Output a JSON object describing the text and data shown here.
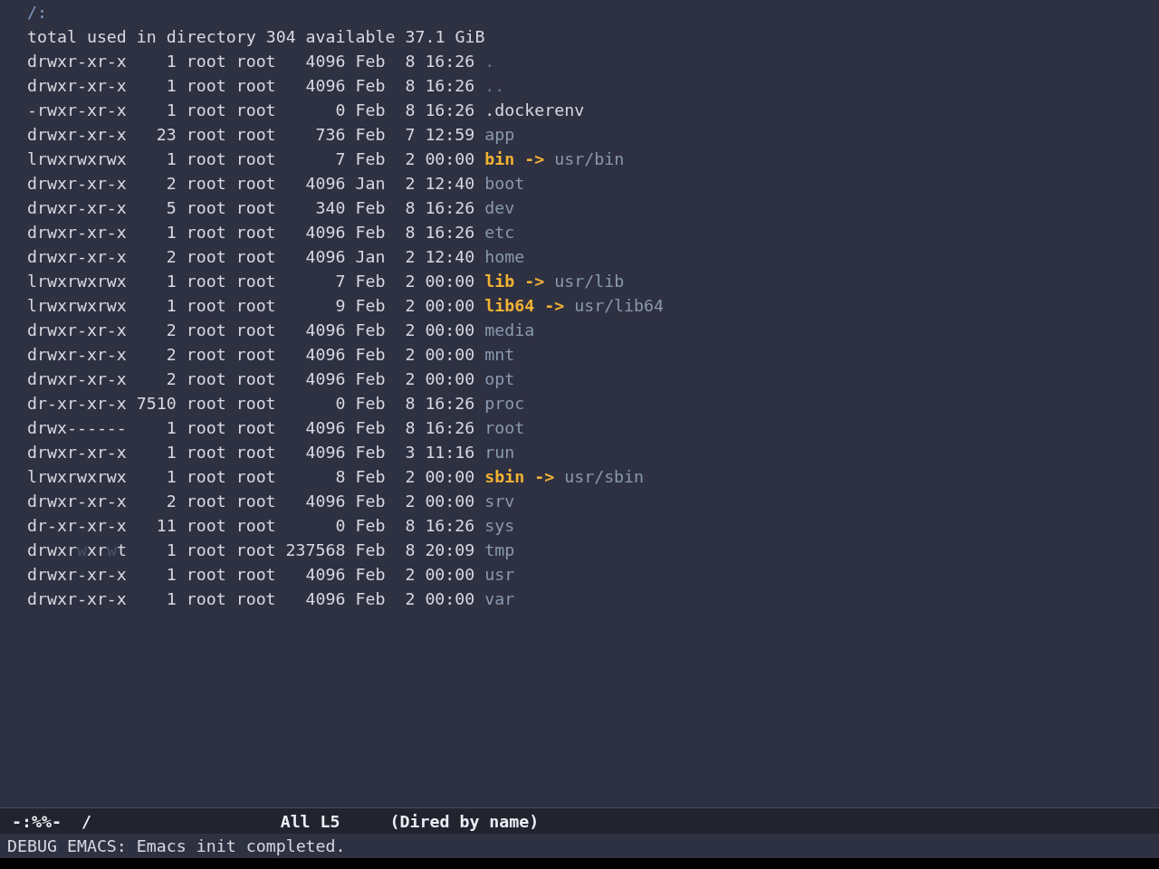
{
  "buffer": {
    "header": "/:",
    "summary": "total used in directory 304 available 37.1 GiB",
    "entries": [
      {
        "kind": "dot",
        "perms": "drwxr-xr-x",
        "write_highlight": false,
        "links": "1",
        "owner": "root",
        "group": "root",
        "size": "4096",
        "month": "Feb",
        "day": "8",
        "time": "16:26",
        "name": "."
      },
      {
        "kind": "dot",
        "perms": "drwxr-xr-x",
        "write_highlight": false,
        "links": "1",
        "owner": "root",
        "group": "root",
        "size": "4096",
        "month": "Feb",
        "day": "8",
        "time": "16:26",
        "name": ".."
      },
      {
        "kind": "file",
        "perms": "-rwxr-xr-x",
        "write_highlight": false,
        "links": "1",
        "owner": "root",
        "group": "root",
        "size": "0",
        "month": "Feb",
        "day": "8",
        "time": "16:26",
        "name": ".dockerenv"
      },
      {
        "kind": "dir",
        "perms": "drwxr-xr-x",
        "write_highlight": false,
        "links": "23",
        "owner": "root",
        "group": "root",
        "size": "736",
        "month": "Feb",
        "day": "7",
        "time": "12:59",
        "name": "app"
      },
      {
        "kind": "symlink",
        "perms": "lrwxrwxrwx",
        "write_highlight": false,
        "links": "1",
        "owner": "root",
        "group": "root",
        "size": "7",
        "month": "Feb",
        "day": "2",
        "time": "00:00",
        "name": "bin",
        "arrow": "->",
        "target": "usr/bin"
      },
      {
        "kind": "dir",
        "perms": "drwxr-xr-x",
        "write_highlight": false,
        "links": "2",
        "owner": "root",
        "group": "root",
        "size": "4096",
        "month": "Jan",
        "day": "2",
        "time": "12:40",
        "name": "boot"
      },
      {
        "kind": "dir",
        "perms": "drwxr-xr-x",
        "write_highlight": false,
        "links": "5",
        "owner": "root",
        "group": "root",
        "size": "340",
        "month": "Feb",
        "day": "8",
        "time": "16:26",
        "name": "dev"
      },
      {
        "kind": "dir",
        "perms": "drwxr-xr-x",
        "write_highlight": false,
        "links": "1",
        "owner": "root",
        "group": "root",
        "size": "4096",
        "month": "Feb",
        "day": "8",
        "time": "16:26",
        "name": "etc"
      },
      {
        "kind": "dir",
        "perms": "drwxr-xr-x",
        "write_highlight": false,
        "links": "2",
        "owner": "root",
        "group": "root",
        "size": "4096",
        "month": "Jan",
        "day": "2",
        "time": "12:40",
        "name": "home"
      },
      {
        "kind": "symlink",
        "perms": "lrwxrwxrwx",
        "write_highlight": false,
        "links": "1",
        "owner": "root",
        "group": "root",
        "size": "7",
        "month": "Feb",
        "day": "2",
        "time": "00:00",
        "name": "lib",
        "arrow": "->",
        "target": "usr/lib"
      },
      {
        "kind": "symlink",
        "perms": "lrwxrwxrwx",
        "write_highlight": false,
        "links": "1",
        "owner": "root",
        "group": "root",
        "size": "9",
        "month": "Feb",
        "day": "2",
        "time": "00:00",
        "name": "lib64",
        "arrow": "->",
        "target": "usr/lib64"
      },
      {
        "kind": "dir",
        "perms": "drwxr-xr-x",
        "write_highlight": false,
        "links": "2",
        "owner": "root",
        "group": "root",
        "size": "4096",
        "month": "Feb",
        "day": "2",
        "time": "00:00",
        "name": "media"
      },
      {
        "kind": "dir",
        "perms": "drwxr-xr-x",
        "write_highlight": false,
        "links": "2",
        "owner": "root",
        "group": "root",
        "size": "4096",
        "month": "Feb",
        "day": "2",
        "time": "00:00",
        "name": "mnt"
      },
      {
        "kind": "dir",
        "perms": "drwxr-xr-x",
        "write_highlight": false,
        "links": "2",
        "owner": "root",
        "group": "root",
        "size": "4096",
        "month": "Feb",
        "day": "2",
        "time": "00:00",
        "name": "opt"
      },
      {
        "kind": "dir",
        "perms": "dr-xr-xr-x",
        "write_highlight": false,
        "links": "7510",
        "owner": "root",
        "group": "root",
        "size": "0",
        "month": "Feb",
        "day": "8",
        "time": "16:26",
        "name": "proc"
      },
      {
        "kind": "dir",
        "perms": "drwx------",
        "write_highlight": false,
        "links": "1",
        "owner": "root",
        "group": "root",
        "size": "4096",
        "month": "Feb",
        "day": "8",
        "time": "16:26",
        "name": "root"
      },
      {
        "kind": "dir",
        "perms": "drwxr-xr-x",
        "write_highlight": false,
        "links": "1",
        "owner": "root",
        "group": "root",
        "size": "4096",
        "month": "Feb",
        "day": "3",
        "time": "11:16",
        "name": "run"
      },
      {
        "kind": "symlink",
        "perms": "lrwxrwxrwx",
        "write_highlight": false,
        "links": "1",
        "owner": "root",
        "group": "root",
        "size": "8",
        "month": "Feb",
        "day": "2",
        "time": "00:00",
        "name": "sbin",
        "arrow": "->",
        "target": "usr/sbin"
      },
      {
        "kind": "dir",
        "perms": "drwxr-xr-x",
        "write_highlight": false,
        "links": "2",
        "owner": "root",
        "group": "root",
        "size": "4096",
        "month": "Feb",
        "day": "2",
        "time": "00:00",
        "name": "srv"
      },
      {
        "kind": "dir",
        "perms": "dr-xr-xr-x",
        "write_highlight": false,
        "links": "11",
        "owner": "root",
        "group": "root",
        "size": "0",
        "month": "Feb",
        "day": "8",
        "time": "16:26",
        "name": "sys"
      },
      {
        "kind": "dir",
        "perms": "drwxrwxrwt",
        "write_highlight": true,
        "links": "1",
        "owner": "root",
        "group": "root",
        "size": "237568",
        "month": "Feb",
        "day": "8",
        "time": "20:09",
        "name": "tmp"
      },
      {
        "kind": "dir",
        "perms": "drwxr-xr-x",
        "write_highlight": false,
        "links": "1",
        "owner": "root",
        "group": "root",
        "size": "4096",
        "month": "Feb",
        "day": "2",
        "time": "00:00",
        "name": "usr"
      },
      {
        "kind": "dir",
        "perms": "drwxr-xr-x",
        "write_highlight": false,
        "links": "1",
        "owner": "root",
        "group": "root",
        "size": "4096",
        "month": "Feb",
        "day": "2",
        "time": "00:00",
        "name": "var"
      }
    ]
  },
  "mode_line": {
    "status": "-:%%-",
    "buffer_name": "/",
    "position": "All",
    "line": "L5",
    "mode": "(Dired by name)"
  },
  "echo_area": {
    "message": "DEBUG EMACS: Emacs init completed."
  }
}
